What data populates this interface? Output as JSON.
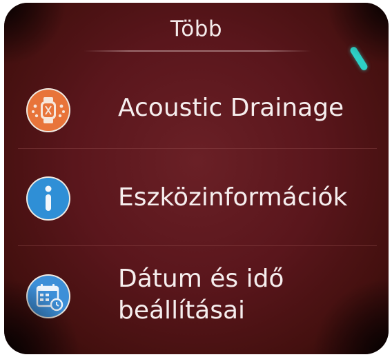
{
  "header": {
    "title": "Több"
  },
  "menu": {
    "items": [
      {
        "label": "Acoustic Drainage",
        "icon": "watch-drainage-icon",
        "icon_color": "#e8743a"
      },
      {
        "label": "Eszközinformációk",
        "icon": "info-icon",
        "icon_color": "#2f8fd6"
      },
      {
        "label_line1": "Dátum és idő",
        "label_line2": "beállításai",
        "icon": "calendar-clock-icon",
        "icon_color": "#3d8fd8"
      }
    ]
  },
  "colors": {
    "background": "#5a161c",
    "text": "#f6eeee",
    "scroll_indicator": "#2ed0c6"
  }
}
